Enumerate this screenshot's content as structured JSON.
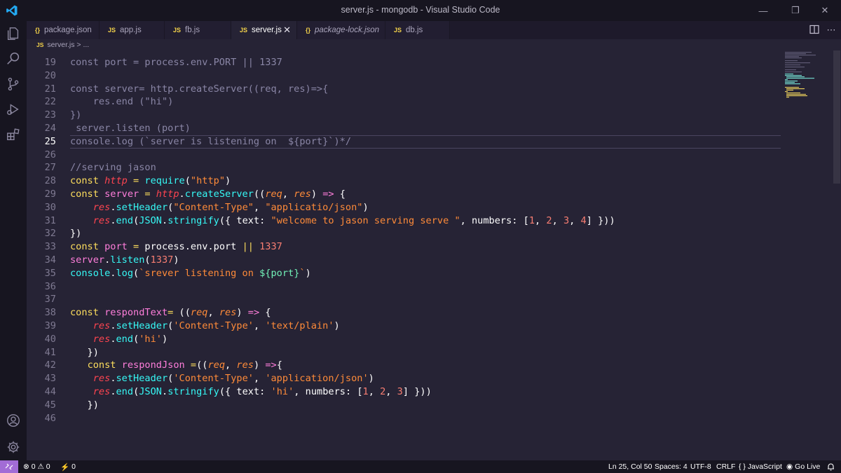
{
  "window": {
    "title": "server.js - mongodb - Visual Studio Code",
    "controls": {
      "minimize": "—",
      "restore": "❐",
      "close": "✕"
    }
  },
  "activity_bar": [
    {
      "name": "explorer-icon"
    },
    {
      "name": "search-icon"
    },
    {
      "name": "source-control-icon"
    },
    {
      "name": "run-debug-icon"
    },
    {
      "name": "extensions-icon"
    },
    {
      "name": "accounts-icon"
    },
    {
      "name": "manage-gear-icon"
    }
  ],
  "tabs": [
    {
      "label": "package.json",
      "icon": "{}",
      "active": false,
      "italic": false
    },
    {
      "label": "app.js",
      "icon": "JS",
      "active": false,
      "italic": false
    },
    {
      "label": "fb.js",
      "icon": "JS",
      "active": false,
      "italic": false
    },
    {
      "label": "server.js",
      "icon": "JS",
      "active": true,
      "italic": false
    },
    {
      "label": "package-lock.json",
      "icon": "{}",
      "active": false,
      "italic": true
    },
    {
      "label": "db.js",
      "icon": "JS",
      "active": false,
      "italic": false
    }
  ],
  "tab_close_glyph": "✕",
  "breadcrumb": {
    "icon": "JS",
    "file": "server.js",
    "sep": " > ...",
    "text": "server.js > ..."
  },
  "editor": {
    "cursor_line": 25,
    "lines": [
      {
        "n": "19",
        "tokens": [
          [
            "comment",
            "const port = process.env.PORT || 1337"
          ]
        ]
      },
      {
        "n": "20",
        "tokens": []
      },
      {
        "n": "21",
        "tokens": [
          [
            "comment",
            "const server= http.createServer((req, res)=>{"
          ]
        ]
      },
      {
        "n": "22",
        "tokens": [
          [
            "comment",
            "    res.end (\"hi\")"
          ]
        ]
      },
      {
        "n": "23",
        "tokens": [
          [
            "comment",
            "})"
          ]
        ]
      },
      {
        "n": "24",
        "tokens": [
          [
            "comment",
            " server.listen (port)"
          ]
        ]
      },
      {
        "n": "25",
        "tokens": [
          [
            "comment",
            "console.log (`server is listening on  ${port}`)*/"
          ]
        ]
      },
      {
        "n": "26",
        "tokens": []
      },
      {
        "n": "27",
        "tokens": [
          [
            "comment",
            "//serving jason"
          ]
        ]
      },
      {
        "n": "28",
        "tokens": [
          [
            "kw",
            "const "
          ],
          [
            "obj",
            "http"
          ],
          [
            "op",
            " = "
          ],
          [
            "fn",
            "require"
          ],
          [
            "pl",
            "("
          ],
          [
            "str",
            "\"http\""
          ],
          [
            "pl",
            ")"
          ]
        ]
      },
      {
        "n": "29",
        "tokens": [
          [
            "kw",
            "const "
          ],
          [
            "var",
            "server"
          ],
          [
            "op",
            " = "
          ],
          [
            "obj",
            "http"
          ],
          [
            "pl",
            "."
          ],
          [
            "fn",
            "createServer"
          ],
          [
            "pl",
            "(("
          ],
          [
            "param",
            "req"
          ],
          [
            "pl",
            ", "
          ],
          [
            "param",
            "res"
          ],
          [
            "pl",
            ") "
          ],
          [
            "def",
            "=>"
          ],
          [
            "pl",
            " {"
          ]
        ]
      },
      {
        "n": "30",
        "tokens": [
          [
            "pl",
            "    "
          ],
          [
            "obj",
            "res"
          ],
          [
            "pl",
            "."
          ],
          [
            "fn",
            "setHeader"
          ],
          [
            "pl",
            "("
          ],
          [
            "str",
            "\"Content-Type\""
          ],
          [
            "pl",
            ", "
          ],
          [
            "str",
            "\"applicatio/json\""
          ],
          [
            "pl",
            ")"
          ]
        ]
      },
      {
        "n": "31",
        "tokens": [
          [
            "pl",
            "    "
          ],
          [
            "obj",
            "res"
          ],
          [
            "pl",
            "."
          ],
          [
            "fn",
            "end"
          ],
          [
            "pl",
            "("
          ],
          [
            "fn",
            "JSON"
          ],
          [
            "pl",
            "."
          ],
          [
            "fn",
            "stringify"
          ],
          [
            "pl",
            "({ "
          ],
          [
            "prop",
            "text"
          ],
          [
            "pl",
            ": "
          ],
          [
            "str",
            "\"welcome to jason serving serve \""
          ],
          [
            "pl",
            ", "
          ],
          [
            "prop",
            "numbers"
          ],
          [
            "pl",
            ": ["
          ],
          [
            "num",
            "1"
          ],
          [
            "pl",
            ", "
          ],
          [
            "num",
            "2"
          ],
          [
            "pl",
            ", "
          ],
          [
            "num",
            "3"
          ],
          [
            "pl",
            ", "
          ],
          [
            "num",
            "4"
          ],
          [
            "pl",
            "] }))"
          ]
        ]
      },
      {
        "n": "32",
        "tokens": [
          [
            "pl",
            "})"
          ]
        ]
      },
      {
        "n": "33",
        "tokens": [
          [
            "kw",
            "const "
          ],
          [
            "var",
            "port"
          ],
          [
            "op",
            " = "
          ],
          [
            "pl",
            "process.env.port "
          ],
          [
            "op",
            "||"
          ],
          [
            "pl",
            " "
          ],
          [
            "num",
            "1337"
          ]
        ]
      },
      {
        "n": "34",
        "tokens": [
          [
            "var",
            "server"
          ],
          [
            "pl",
            "."
          ],
          [
            "fn",
            "listen"
          ],
          [
            "pl",
            "("
          ],
          [
            "num",
            "1337"
          ],
          [
            "pl",
            ")"
          ]
        ]
      },
      {
        "n": "35",
        "tokens": [
          [
            "fn",
            "console"
          ],
          [
            "pl",
            "."
          ],
          [
            "fn",
            "log"
          ],
          [
            "pl",
            "("
          ],
          [
            "str",
            "`srever listening on "
          ],
          [
            "tmpl",
            "${port}"
          ],
          [
            "str",
            "`"
          ],
          [
            "pl",
            ")"
          ]
        ]
      },
      {
        "n": "36",
        "tokens": []
      },
      {
        "n": "37",
        "tokens": []
      },
      {
        "n": "38",
        "tokens": [
          [
            "kw",
            "const "
          ],
          [
            "var",
            "respondText"
          ],
          [
            "op",
            "= "
          ],
          [
            "pl",
            "(("
          ],
          [
            "param",
            "req"
          ],
          [
            "pl",
            ", "
          ],
          [
            "param",
            "res"
          ],
          [
            "pl",
            ") "
          ],
          [
            "def",
            "=>"
          ],
          [
            "pl",
            " {"
          ]
        ]
      },
      {
        "n": "39",
        "tokens": [
          [
            "pl",
            "    "
          ],
          [
            "obj",
            "res"
          ],
          [
            "pl",
            "."
          ],
          [
            "fn",
            "setHeader"
          ],
          [
            "pl",
            "("
          ],
          [
            "str",
            "'Content-Type'"
          ],
          [
            "pl",
            ", "
          ],
          [
            "str",
            "'text/plain'"
          ],
          [
            "pl",
            ")"
          ]
        ]
      },
      {
        "n": "40",
        "tokens": [
          [
            "pl",
            "    "
          ],
          [
            "obj",
            "res"
          ],
          [
            "pl",
            "."
          ],
          [
            "fn",
            "end"
          ],
          [
            "pl",
            "("
          ],
          [
            "str",
            "'hi'"
          ],
          [
            "pl",
            ")"
          ]
        ]
      },
      {
        "n": "41",
        "tokens": [
          [
            "pl",
            "   })"
          ]
        ]
      },
      {
        "n": "42",
        "tokens": [
          [
            "pl",
            "   "
          ],
          [
            "kw",
            "const "
          ],
          [
            "var",
            "respondJson"
          ],
          [
            "op",
            " ="
          ],
          [
            "pl",
            "(("
          ],
          [
            "param",
            "req"
          ],
          [
            "pl",
            ", "
          ],
          [
            "param",
            "res"
          ],
          [
            "pl",
            ") "
          ],
          [
            "def",
            "=>"
          ],
          [
            "pl",
            "{"
          ]
        ]
      },
      {
        "n": "43",
        "tokens": [
          [
            "pl",
            "    "
          ],
          [
            "obj",
            "res"
          ],
          [
            "pl",
            "."
          ],
          [
            "fn",
            "setHeader"
          ],
          [
            "pl",
            "("
          ],
          [
            "str",
            "'Content-Type'"
          ],
          [
            "pl",
            ", "
          ],
          [
            "str",
            "'application/json'"
          ],
          [
            "pl",
            ")"
          ]
        ]
      },
      {
        "n": "44",
        "tokens": [
          [
            "pl",
            "    "
          ],
          [
            "obj",
            "res"
          ],
          [
            "pl",
            "."
          ],
          [
            "fn",
            "end"
          ],
          [
            "pl",
            "("
          ],
          [
            "fn",
            "JSON"
          ],
          [
            "pl",
            "."
          ],
          [
            "fn",
            "stringify"
          ],
          [
            "pl",
            "({ "
          ],
          [
            "prop",
            "text"
          ],
          [
            "pl",
            ": "
          ],
          [
            "str",
            "'hi'"
          ],
          [
            "pl",
            ", "
          ],
          [
            "prop",
            "numbers"
          ],
          [
            "pl",
            ": ["
          ],
          [
            "num",
            "1"
          ],
          [
            "pl",
            ", "
          ],
          [
            "num",
            "2"
          ],
          [
            "pl",
            ", "
          ],
          [
            "num",
            "3"
          ],
          [
            "pl",
            "] }))"
          ]
        ]
      },
      {
        "n": "45",
        "tokens": [
          [
            "pl",
            "   })"
          ]
        ]
      },
      {
        "n": "46",
        "tokens": []
      }
    ]
  },
  "status_bar": {
    "problems": "⊗ 0 ⚠ 0",
    "ports": "0",
    "position": "Ln 25, Col 50",
    "spaces": "Spaces: 4",
    "encoding": "UTF-8",
    "eol": "CRLF",
    "language": "{ } JavaScript",
    "golive": "Go Live"
  },
  "colors": {
    "background": "#262335",
    "titlebar": "#171520",
    "keyword": "#fede5d",
    "function": "#36f9f6",
    "string": "#ff8b39",
    "number": "#f97e72",
    "comment": "#8a86a6",
    "remote_indicator": "#a26cd6"
  }
}
